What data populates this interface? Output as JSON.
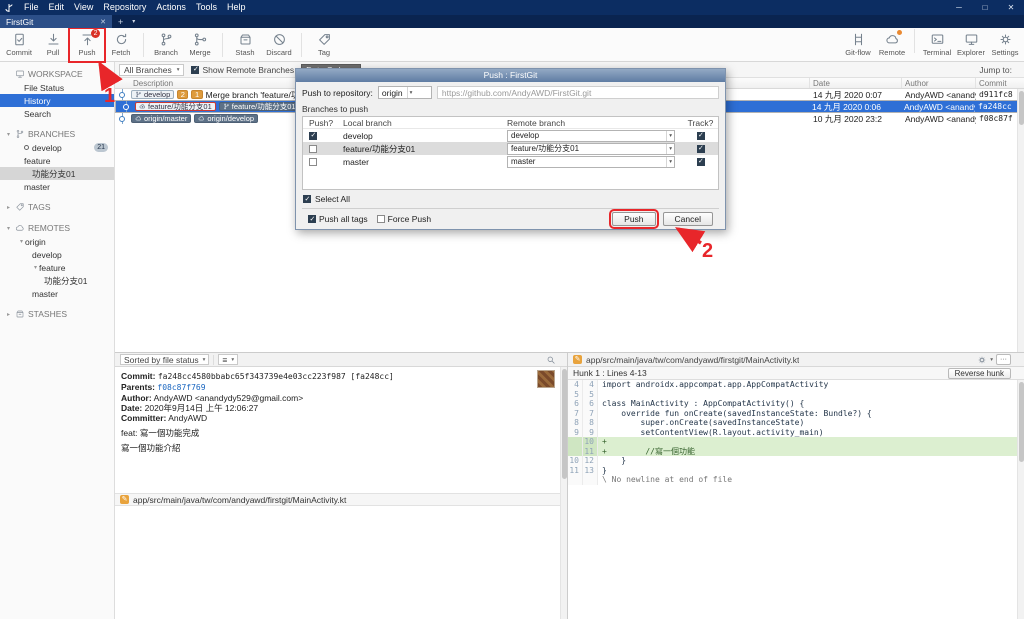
{
  "window": {
    "menus": [
      "File",
      "Edit",
      "View",
      "Repository",
      "Actions",
      "Tools",
      "Help"
    ],
    "tab": "FirstGit"
  },
  "icons": {
    "minimize": "─",
    "maximize": "□",
    "close": "✕",
    "tab_close": "✕",
    "plus": "+",
    "chevron_down": "▾",
    "chevron_right": "▸",
    "more": "···",
    "menu": "≡"
  },
  "toolbar": {
    "labels": [
      "Commit",
      "Pull",
      "Push",
      "Fetch",
      "Branch",
      "Merge",
      "Stash",
      "Discard",
      "Tag",
      "Git-flow",
      "Remote",
      "Terminal",
      "Explorer",
      "Settings"
    ],
    "push_badge": "2"
  },
  "sidebar": {
    "workspace": "WORKSPACE",
    "file_status": "File Status",
    "history": "History",
    "search": "Search",
    "branches": "BRANCHES",
    "develop": "develop",
    "develop_badge": "21",
    "feature": "feature",
    "feature_branch": "功能分支01",
    "master": "master",
    "tags": "TAGS",
    "remotes": "REMOTES",
    "origin": "origin",
    "remote_develop": "develop",
    "remote_feature": "feature",
    "remote_feature_branch": "功能分支01",
    "remote_master": "master",
    "stashes": "STASHES"
  },
  "filterbar": {
    "all_branches": "All Branches",
    "show_remote": "Show Remote Branches",
    "date_order": "Date Order",
    "jump_to": "Jump to:"
  },
  "graph": {
    "columns": {
      "description": "Description",
      "date": "Date",
      "author": "Author",
      "commit": "Commit"
    },
    "rows": [
      {
        "branch": "develop",
        "ahead": "2",
        "behind": "1",
        "message": "Merge branch 'feature/功能分支01' into develop",
        "date": "14 九月 2020 0:07",
        "author": "AndyAWD <anandydy529@gmail.com>",
        "commit": "d911fc8"
      },
      {
        "remote_badge": "feature/功能分支01",
        "local_badge": "feature/功能分支01",
        "message": "feat: 寫一個功能完成",
        "date": "14 九月 2020 0:06",
        "author": "AndyAWD <anandydy529@gmail.com>",
        "commit": "fa248cc"
      },
      {
        "badge1": "origin/master",
        "badge2": "origin/develop",
        "message": "",
        "date": "10 九月 2020 23:2",
        "author": "AndyAWD <anandydy529@gmail.com>",
        "commit": "f08c87f"
      }
    ]
  },
  "dialog": {
    "title": "Push : FirstGit",
    "repo_label": "Push to repository:",
    "repo_value": "origin",
    "repo_url": "https://github.com/AndyAWD/FirstGit.git",
    "group_label": "Branches to push",
    "col_push": "Push?",
    "col_local": "Local branch",
    "col_remote": "Remote branch",
    "col_track": "Track?",
    "rows": [
      {
        "local": "develop",
        "remote": "develop"
      },
      {
        "local": "feature/功能分支01",
        "remote": "feature/功能分支01"
      },
      {
        "local": "master",
        "remote": "master"
      }
    ],
    "select_all": "Select All",
    "push_all_tags": "Push all tags",
    "force_push": "Force Push",
    "push_button": "Push",
    "cancel_button": "Cancel"
  },
  "commit_panel": {
    "sort_label": "Sorted by file status",
    "commit_label": "Commit:",
    "commit_hash": "fa248cc4580bbabc65f343739e4e03cc223f987 [fa248cc]",
    "parents_label": "Parents:",
    "parents": "f08c87f769",
    "author_label": "Author:",
    "author": "AndyAWD <anandydy529@gmail.com>",
    "date_label": "Date:",
    "date": "2020年9月14日 上午 12:06:27",
    "committer_label": "Committer:",
    "committer": "AndyAWD",
    "subject": "feat: 寫一個功能完成",
    "body": "寫一個功能介紹",
    "file": "app/src/main/java/tw/com/andyawd/firstgit/MainActivity.kt"
  },
  "diff": {
    "path": "app/src/main/java/tw/com/andyawd/firstgit/MainActivity.kt",
    "hunk_label": "Hunk 1 : Lines 4-13",
    "reverse_button": "Reverse hunk",
    "no_newline": "\\ No newline at end of file",
    "lines": [
      {
        "old": "4",
        "new": "4",
        "text": "import androidx.appcompat.app.AppCompatActivity"
      },
      {
        "old": "5",
        "new": "5",
        "text": ""
      },
      {
        "old": "6",
        "new": "6",
        "text": "class MainActivity : AppCompatActivity() {"
      },
      {
        "old": "7",
        "new": "7",
        "text": "    override fun onCreate(savedInstanceState: Bundle?) {"
      },
      {
        "old": "8",
        "new": "8",
        "text": "        super.onCreate(savedInstanceState)"
      },
      {
        "old": "9",
        "new": "9",
        "text": "        setContentView(R.layout.activity_main)"
      },
      {
        "old": "",
        "new": "10",
        "text": "+"
      },
      {
        "old": "",
        "new": "11",
        "text": "+        //寫一個功能"
      },
      {
        "old": "10",
        "new": "12",
        "text": "    }"
      },
      {
        "old": "11",
        "new": "13",
        "text": "}"
      }
    ]
  },
  "annotations": {
    "step1": "1",
    "step2": "2"
  }
}
